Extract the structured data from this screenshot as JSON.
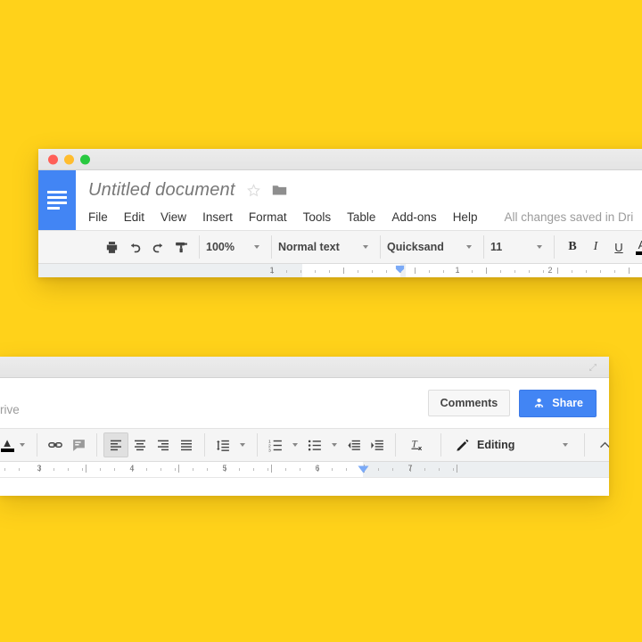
{
  "background": {
    "color": "#FFD21A"
  },
  "top_window": {
    "traffic_lights": [
      "close",
      "minimize",
      "maximize"
    ],
    "doc_title": "Untitled document",
    "menus": [
      "File",
      "Edit",
      "View",
      "Insert",
      "Format",
      "Tools",
      "Table",
      "Add-ons",
      "Help"
    ],
    "save_status": "All changes saved in Dri",
    "toolbar": {
      "print": "print-icon",
      "undo": "undo-icon",
      "redo": "redo-icon",
      "paint_format": "paint-format-icon",
      "zoom_value": "100%",
      "style_value": "Normal text",
      "font_value": "Quicksand",
      "size_value": "11",
      "bold": "B",
      "italic": "I",
      "underline": "U",
      "text_color": "A"
    },
    "ruler": {
      "numbers": [
        "1",
        "1",
        "2"
      ],
      "indent_marker_color": "#7baaf7"
    }
  },
  "bottom_window": {
    "save_status_tail": "rive",
    "comments_label": "Comments",
    "share_label": "Share",
    "share_color": "#4285f4",
    "expand_icon": "expand-arrows-icon",
    "toolbar": {
      "highlight": "highlight-color-icon",
      "link": "link-icon",
      "add_comment": "add-comment-icon",
      "align_left": "align-left-icon",
      "align_center": "align-center-icon",
      "align_right": "align-right-icon",
      "align_justify": "align-justify-icon",
      "line_spacing": "line-spacing-icon",
      "numbered_list": "numbered-list-icon",
      "bulleted_list": "bulleted-list-icon",
      "decrease_indent": "decrease-indent-icon",
      "increase_indent": "increase-indent-icon",
      "clear_formatting": "clear-formatting-icon",
      "mode_icon": "pencil-icon",
      "mode_label": "Editing",
      "collapse": "collapse-chevron-icon"
    },
    "ruler": {
      "numbers": [
        "3",
        "4",
        "5",
        "6",
        "7"
      ],
      "indent_marker_color": "#7baaf7"
    }
  }
}
